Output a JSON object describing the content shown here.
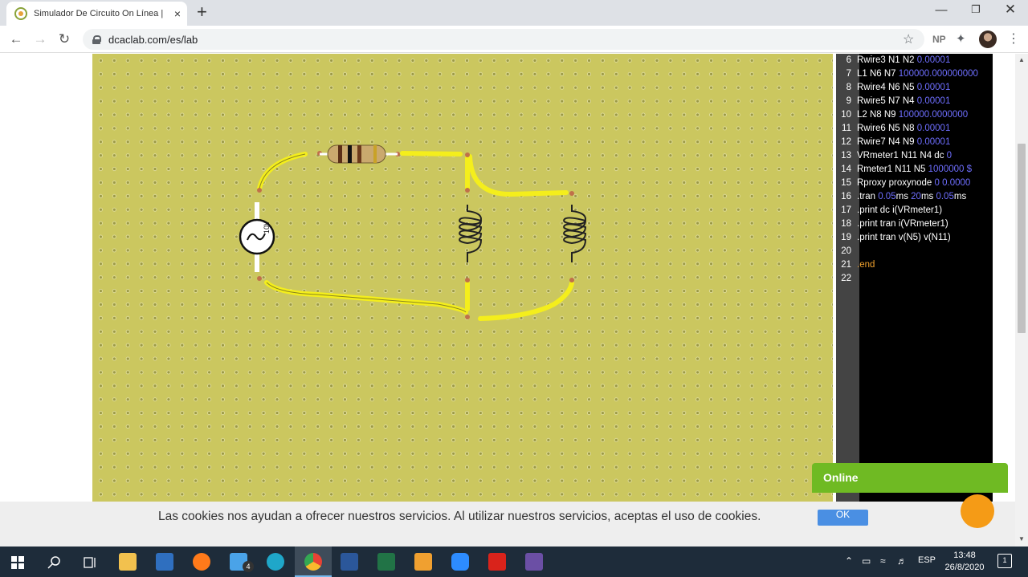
{
  "browser": {
    "tab_title": "Simulador De Circuito On Línea |",
    "url": "dcaclab.com/es/lab",
    "profile_label": "NP",
    "new_tab": "+",
    "close_tab": "×"
  },
  "circuit": {
    "source_label": "10V"
  },
  "editor": {
    "lines": [
      {
        "n": "6",
        "text": "Rwire3 N1 N2 ",
        "val": "0.00001",
        "kw": ""
      },
      {
        "n": "7",
        "text": "L1 N6 N7 ",
        "val": "100000.000000000",
        "kw": ""
      },
      {
        "n": "8",
        "text": "Rwire4 N6 N5 ",
        "val": "0.00001",
        "kw": ""
      },
      {
        "n": "9",
        "text": "Rwire5 N7 N4 ",
        "val": "0.00001",
        "kw": ""
      },
      {
        "n": "10",
        "text": "L2 N8 N9 ",
        "val": "100000.0000000",
        "kw": ""
      },
      {
        "n": "11",
        "text": "Rwire6 N5 N8 ",
        "val": "0.00001",
        "kw": ""
      },
      {
        "n": "12",
        "text": "Rwire7 N4 N9 ",
        "val": "0.00001",
        "kw": ""
      },
      {
        "n": "13",
        "text": "VRmeter1 N11 N4 dc ",
        "val": "0",
        "kw": ""
      },
      {
        "n": "14",
        "text": "Rmeter1 N11 N5 ",
        "val": "1000000 $",
        "kw": ""
      },
      {
        "n": "15",
        "text": "Rproxy proxynode ",
        "val": "0 0.0000",
        "kw": ""
      },
      {
        "n": "16",
        "text": ".tran ",
        "val": "0.05",
        "text2": "ms ",
        "val2": "20",
        "text3": "ms ",
        "val3": "0.05",
        "text4": "ms",
        "kw": ""
      },
      {
        "n": "17",
        "text": ".print dc i(VRmeter1)",
        "val": "",
        "kw": ""
      },
      {
        "n": "18",
        "text": ".print tran i(VRmeter1)",
        "val": "",
        "kw": ""
      },
      {
        "n": "19",
        "text": ".print tran v(N5) v(N11)",
        "val": "",
        "kw": ""
      },
      {
        "n": "20",
        "text": "",
        "val": "",
        "kw": ""
      },
      {
        "n": "21",
        "text": "",
        "val": "",
        "kw": ".end"
      },
      {
        "n": "22",
        "text": "",
        "val": "",
        "kw": ""
      }
    ]
  },
  "cookie_banner": {
    "text": "Las cookies nos ayudan a ofrecer nuestros servicios. Al utilizar nuestros servicios, aceptas el uso de cookies.",
    "ok_label": "OK"
  },
  "chat_widget": {
    "label": "Online"
  },
  "taskbar": {
    "mail_badge": "4",
    "language": "ESP",
    "time": "13:48",
    "date": "26/8/2020",
    "notification_count": "1"
  }
}
